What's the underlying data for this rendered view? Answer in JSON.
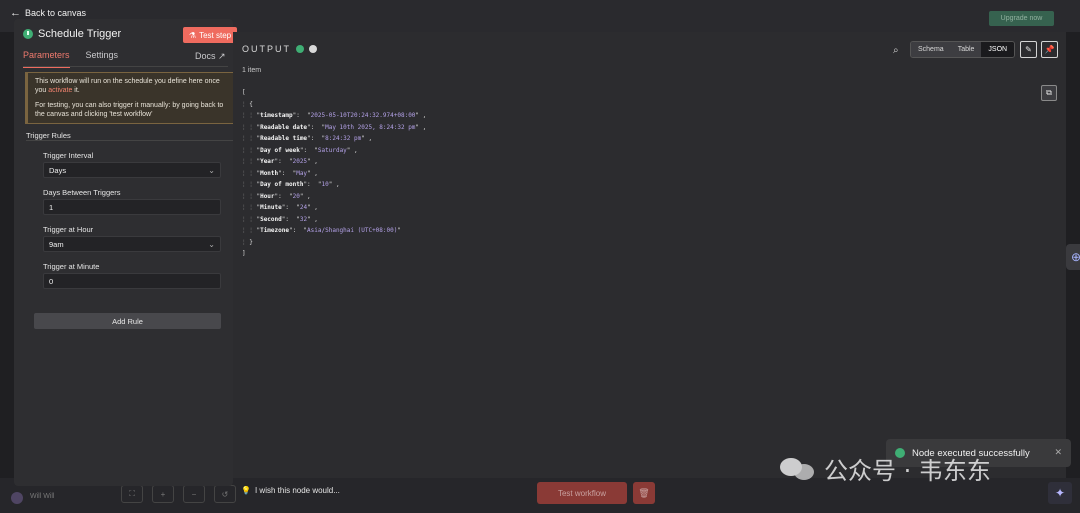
{
  "nav": {
    "back_label": "Back to canvas",
    "upgrade_label": "Upgrade now"
  },
  "node_panel": {
    "title": "Schedule Trigger",
    "test_step_label": "Test step",
    "tabs": [
      {
        "label": "Parameters",
        "active": true
      },
      {
        "label": "Settings",
        "active": false
      }
    ],
    "docs_label": "Docs",
    "notice": {
      "line1_prefix": "This workflow will run on the schedule you define here once you ",
      "line1_link": "activate",
      "line1_suffix": " it.",
      "line2": "For testing, you can also trigger it manually: by going back to the canvas and clicking 'test workflow'"
    },
    "section_title": "Trigger Rules",
    "fields": [
      {
        "label": "Trigger Interval",
        "value": "Days",
        "type": "select"
      },
      {
        "label": "Days Between Triggers",
        "value": "1",
        "type": "input"
      },
      {
        "label": "Trigger at Hour",
        "value": "9am",
        "type": "select"
      },
      {
        "label": "Trigger at Minute",
        "value": "0",
        "type": "input"
      }
    ],
    "add_rule_label": "Add Rule"
  },
  "wish_label": "I wish this node would...",
  "output": {
    "title": "OUTPUT",
    "item_count": "1 item",
    "view_modes": [
      {
        "label": "Schema",
        "active": false
      },
      {
        "label": "Table",
        "active": false
      },
      {
        "label": "JSON",
        "active": true
      }
    ],
    "json_rows": [
      {
        "key": "timestamp",
        "value": "2025-05-10T20:24:32.974+08:00"
      },
      {
        "key": "Readable date",
        "value": "May 10th 2025, 8:24:32 pm"
      },
      {
        "key": "Readable time",
        "value": "8:24:32 pm"
      },
      {
        "key": "Day of week",
        "value": "Saturday"
      },
      {
        "key": "Year",
        "value": "2025"
      },
      {
        "key": "Month",
        "value": "May"
      },
      {
        "key": "Day of month",
        "value": "10"
      },
      {
        "key": "Hour",
        "value": "20"
      },
      {
        "key": "Minute",
        "value": "24"
      },
      {
        "key": "Second",
        "value": "32"
      },
      {
        "key": "Timezone",
        "value": "Asia/Shanghai (UTC+08:00)"
      }
    ]
  },
  "bottom": {
    "user_name": "Will Will",
    "test_workflow_label": "Test workflow"
  },
  "toast": {
    "message": "Node executed successfully"
  },
  "watermark": {
    "text": "公众号 · 韦东东"
  },
  "colors": {
    "accent": "#ef6b5f",
    "success": "#3fae74",
    "json_value": "#b4a2e8",
    "notice_border": "#e8a347"
  }
}
